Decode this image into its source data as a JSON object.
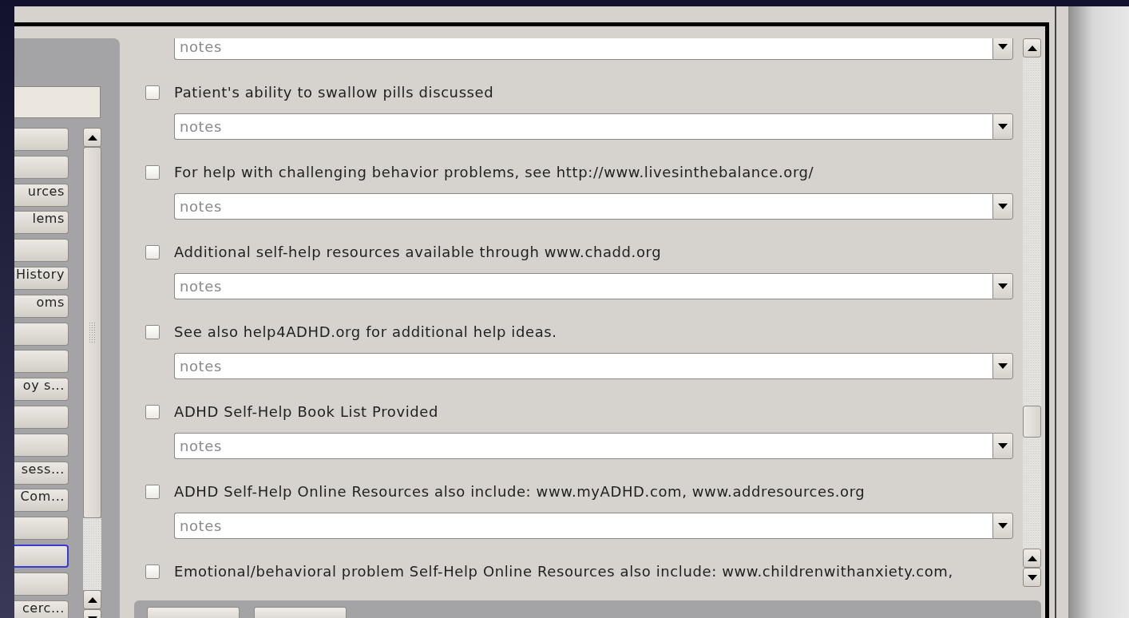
{
  "sidebar": {
    "buttons": [
      {
        "selected": false
      },
      {
        "selected": false
      },
      {
        "label": "urces",
        "selected": false
      },
      {
        "label": "lems",
        "selected": false
      },
      {
        "selected": false
      },
      {
        "label": "History",
        "selected": false
      },
      {
        "label": "oms",
        "selected": false
      },
      {
        "selected": false
      },
      {
        "selected": false
      },
      {
        "label": "oy s...",
        "selected": false
      },
      {
        "selected": false
      },
      {
        "selected": false
      },
      {
        "label": "sess...",
        "selected": false
      },
      {
        "label": "Com...",
        "selected": false
      },
      {
        "selected": false
      },
      {
        "selected": true
      },
      {
        "selected": false
      },
      {
        "label": "cerc...",
        "selected": false
      }
    ]
  },
  "form": {
    "rows": [
      {
        "kind": "notes",
        "placeholder": "notes"
      },
      {
        "kind": "checkbox",
        "label": "Patient's ability to swallow pills discussed",
        "checked": false
      },
      {
        "kind": "notes",
        "placeholder": "notes"
      },
      {
        "kind": "checkbox",
        "label": "For help with challenging behavior problems, see http://www.livesinthebalance.org/",
        "checked": false
      },
      {
        "kind": "notes",
        "placeholder": "notes"
      },
      {
        "kind": "checkbox",
        "label": "Additional self-help resources available through www.chadd.org",
        "checked": false
      },
      {
        "kind": "notes",
        "placeholder": "notes"
      },
      {
        "kind": "checkbox",
        "label": "See also help4ADHD.org for additional help ideas.",
        "checked": false
      },
      {
        "kind": "notes",
        "placeholder": "notes"
      },
      {
        "kind": "checkbox",
        "label": "ADHD Self-Help Book List Provided",
        "checked": false
      },
      {
        "kind": "notes",
        "placeholder": "notes"
      },
      {
        "kind": "checkbox",
        "label": "ADHD Self-Help Online Resources also include: www.myADHD.com, www.addresources.org",
        "checked": false
      },
      {
        "kind": "notes",
        "placeholder": "notes"
      },
      {
        "kind": "checkbox",
        "label": "Emotional/behavioral problem Self-Help Online Resources also include: www.childrenwithanxiety.com,",
        "checked": false
      }
    ]
  }
}
